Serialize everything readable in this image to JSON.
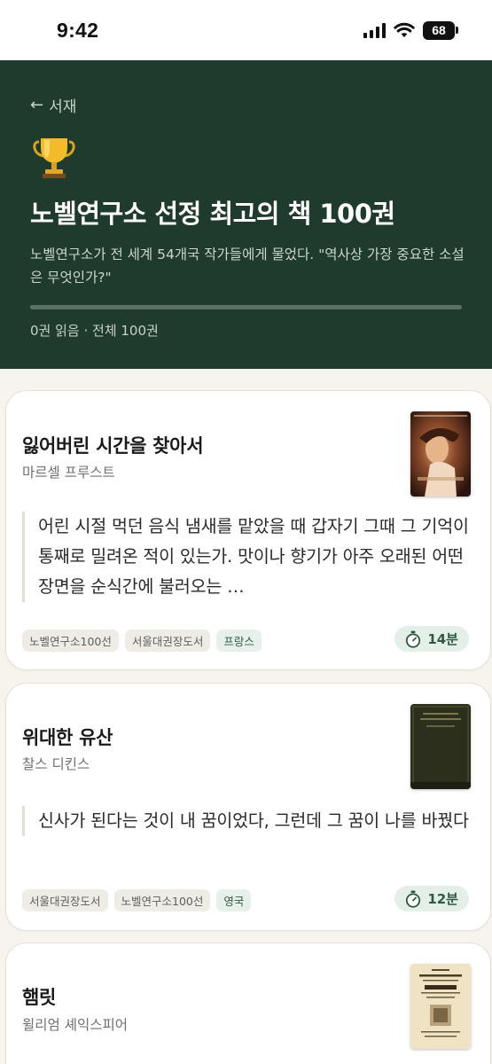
{
  "status_bar": {
    "time": "9:42",
    "battery": "68"
  },
  "header": {
    "back_label": "서재",
    "title": "노벨연구소 선정 최고의 책 100권",
    "description": "노벨연구소가 전 세계 54개국 작가들에게 물었다. \"역사상 가장 중요한 소설은 무엇인가?\"",
    "progress": 0,
    "progress_text": "0권 읽음 · 전체 100권"
  },
  "books": [
    {
      "title": "잃어버린 시간을 찾아서",
      "author": "마르셀 프루스트",
      "quote": "어린 시절 먹던 음식 냄새를 맡았을 때 갑자기 그때 그 기억이 통째로 밀려온 적이 있는가. 맛이나 향기가 아주 오래된 어떤 장면을 순식간에 불러오는 …",
      "tags": [
        "노벨연구소100선",
        "서울대권장도서"
      ],
      "country": "프랑스",
      "time": "14분",
      "cover_icon": "portrait-painting-cover"
    },
    {
      "title": "위대한 유산",
      "author": "찰스 디킨스",
      "quote": "신사가 된다는 것이 내 꿈이었다, 그런데 그 꿈이 나를 바꿨다",
      "tags": [
        "서울대권장도서",
        "노벨연구소100선"
      ],
      "country": "영국",
      "time": "12분",
      "cover_icon": "dark-green-book-cover"
    },
    {
      "title": "햄릿",
      "author": "윌리엄 셰익스피어",
      "cover_icon": "old-print-title-page-cover"
    }
  ],
  "colors": {
    "header_bg": "#1f3b2d",
    "accent": "#2e5a43",
    "page_bg": "#f7f4ee"
  }
}
